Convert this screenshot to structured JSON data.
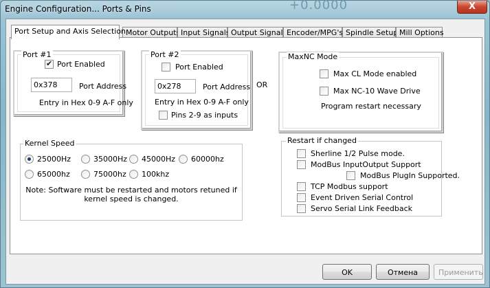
{
  "window": {
    "title": "Engine Configuration... Ports & Pins",
    "bg_text": "+0.0000",
    "close_label": "X"
  },
  "tabs": [
    {
      "label": "Port Setup and Axis Selection",
      "active": true
    },
    {
      "label": "Motor Outputs"
    },
    {
      "label": "Input Signals"
    },
    {
      "label": "Output Signals"
    },
    {
      "label": "Encoder/MPG's"
    },
    {
      "label": "Spindle Setup"
    },
    {
      "label": "Mill Options"
    }
  ],
  "port1": {
    "legend": "Port #1",
    "enabled_label": "Port Enabled",
    "enabled": true,
    "address_value": "0x378",
    "address_label": "Port Address",
    "hint": "Entry in Hex 0-9 A-F only"
  },
  "port2": {
    "legend": "Port #2",
    "enabled_label": "Port Enabled",
    "enabled": false,
    "address_value": "0x278",
    "address_label": "Port Address",
    "hint": "Entry in Hex 0-9 A-F only",
    "pins_label": "Pins 2-9 as inputs"
  },
  "or_label": "OR",
  "maxnc": {
    "legend": "MaxNC Mode",
    "cl_label": "Max CL Mode enabled",
    "nc10_label": "Max NC-10 Wave Drive",
    "restart_note": "Program restart necessary"
  },
  "kernel": {
    "legend": "Kernel Speed",
    "options": [
      "25000Hz",
      "35000Hz",
      "45000Hz",
      "60000hz",
      "65000hz",
      "75000hz",
      "100khz"
    ],
    "selected": "25000Hz",
    "note_line1": "Note: Software must be restarted and motors retuned if",
    "note_line2": "kernel speed is changed."
  },
  "restart": {
    "legend": "Restart if changed",
    "sherline": "Sherline 1/2 Pulse mode.",
    "modbus_io": "ModBus InputOutput Support",
    "modbus_plugin": "ModBus PlugIn Supported.",
    "tcp_modbus": "TCP Modbus support",
    "event_serial": "Event Driven Serial Control",
    "servo_serial": "Servo Serial Link Feedback"
  },
  "buttons": {
    "ok": "OK",
    "cancel": "Отмена",
    "apply": "Применить"
  }
}
